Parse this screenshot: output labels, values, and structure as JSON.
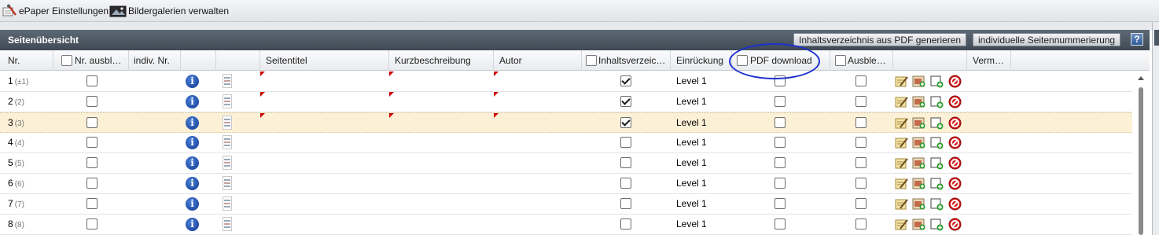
{
  "toolbar": {
    "epaper_settings": "ePaper Einstellungen",
    "gallery_manage": "Bildergalerien verwalten",
    "epaper_settings_icon": "wrench-paper-icon",
    "gallery_icon": "image-gallery-icon"
  },
  "panel": {
    "title": "Seitenübersicht",
    "btn_toc_pdf": "Inhaltsverzeichnis aus PDF generieren",
    "btn_page_numbering": "individuelle Seitennummerierung",
    "help": "?"
  },
  "columns": {
    "nr": "Nr.",
    "nr_hide": "Nr. ausbl…",
    "indiv_nr": "indiv. Nr.",
    "title": "Seitentitel",
    "short_desc": "Kurzbeschreibung",
    "author": "Autor",
    "toc": "Inhaltsverzeic…",
    "indent": "Einrückung",
    "pdf_download": "PDF download",
    "hide": "Ausble…",
    "verm": "Verm…"
  },
  "rows": [
    {
      "nr": "1",
      "sub": "(±1)",
      "indent": "Level 1",
      "toc": true,
      "flags": true,
      "selected": false
    },
    {
      "nr": "2",
      "sub": "(2)",
      "indent": "Level 1",
      "toc": true,
      "flags": true,
      "selected": false
    },
    {
      "nr": "3",
      "sub": "(3)",
      "indent": "Level 1",
      "toc": true,
      "flags": true,
      "selected": true
    },
    {
      "nr": "4",
      "sub": "(4)",
      "indent": "Level 1",
      "toc": false,
      "flags": false,
      "selected": false
    },
    {
      "nr": "5",
      "sub": "(5)",
      "indent": "Level 1",
      "toc": false,
      "flags": false,
      "selected": false
    },
    {
      "nr": "6",
      "sub": "(6)",
      "indent": "Level 1",
      "toc": false,
      "flags": false,
      "selected": false
    },
    {
      "nr": "7",
      "sub": "(7)",
      "indent": "Level 1",
      "toc": false,
      "flags": false,
      "selected": false
    },
    {
      "nr": "8",
      "sub": "(8)",
      "indent": "Level 1",
      "toc": false,
      "flags": false,
      "selected": false
    }
  ],
  "row_icons": {
    "info": "i",
    "info_icon": "info-icon",
    "actions": [
      "edit-page-icon",
      "image-add-icon",
      "add-item-icon",
      "delete-icon"
    ]
  },
  "colors": {
    "header_bg": "#4a5661",
    "selected_row": "#fcf1d7",
    "annotation": "#1d2fd0",
    "flag": "#cc0000"
  }
}
